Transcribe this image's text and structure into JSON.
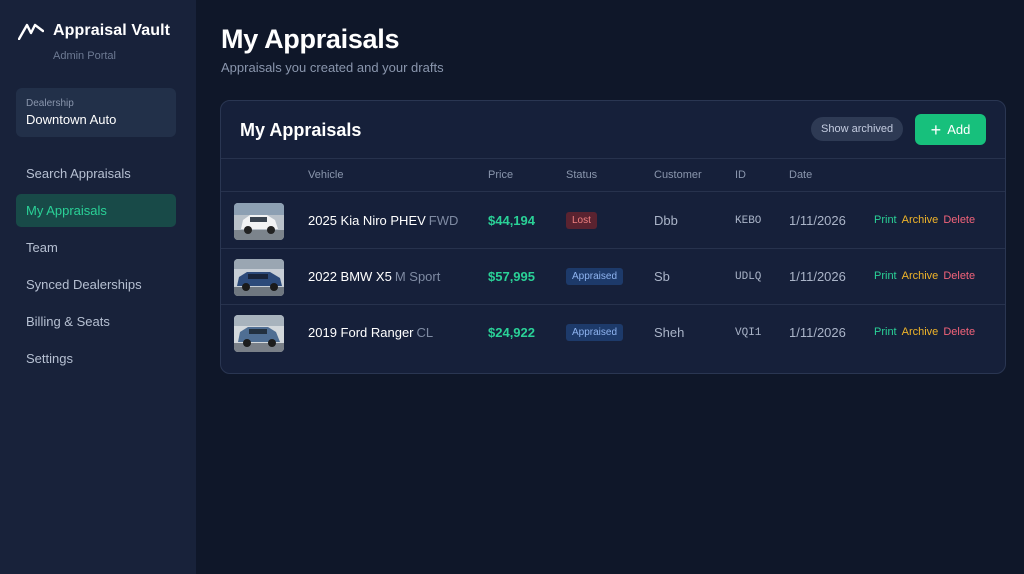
{
  "sidebar": {
    "brand_title": "Appraisal Vault",
    "brand_subtitle": "Admin Portal",
    "dealership_label": "Dealership",
    "dealership_name": "Downtown Auto",
    "nav": [
      {
        "label": "Search Appraisals",
        "active": false
      },
      {
        "label": "My Appraisals",
        "active": true
      },
      {
        "label": "Team",
        "active": false
      },
      {
        "label": "Synced Dealerships",
        "active": false
      },
      {
        "label": "Billing & Seats",
        "active": false
      },
      {
        "label": "Settings",
        "active": false
      }
    ]
  },
  "header": {
    "title": "My Appraisals",
    "subtitle": "Appraisals you created and your drafts"
  },
  "panel": {
    "title": "My Appraisals",
    "show_archived_label": "Show archived",
    "add_label": "Add",
    "columns": [
      "Vehicle",
      "Price",
      "Status",
      "Customer",
      "ID",
      "Date"
    ],
    "rows": [
      {
        "vehicle": "2025 Kia Niro PHEV",
        "trim": "FWD",
        "price": "$44,194",
        "status": "Lost",
        "customer": "Dbb",
        "id": "KEBO",
        "date": "1/11/2026"
      },
      {
        "vehicle": "2022 BMW X5",
        "trim": "M Sport",
        "price": "$57,995",
        "status": "Appraised",
        "customer": "Sb",
        "id": "UDLQ",
        "date": "1/11/2026"
      },
      {
        "vehicle": "2019 Ford Ranger",
        "trim": "CL",
        "price": "$24,922",
        "status": "Appraised",
        "customer": "Sheh",
        "id": "VQI1",
        "date": "1/11/2026"
      }
    ],
    "actions": {
      "print": "Print",
      "archive": "Archive",
      "delete": "Delete"
    }
  },
  "colors": {
    "accent": "#17c07c",
    "background": "#0f1729",
    "sidebar": "#18223a",
    "panel": "#16203a"
  },
  "icons": {
    "brand": "brand-logo-icon",
    "add": "plus-icon",
    "vehicle_thumbs": [
      "vehicle-photo-white-suv",
      "vehicle-photo-blue-suv",
      "vehicle-photo-blue-pickup"
    ]
  }
}
